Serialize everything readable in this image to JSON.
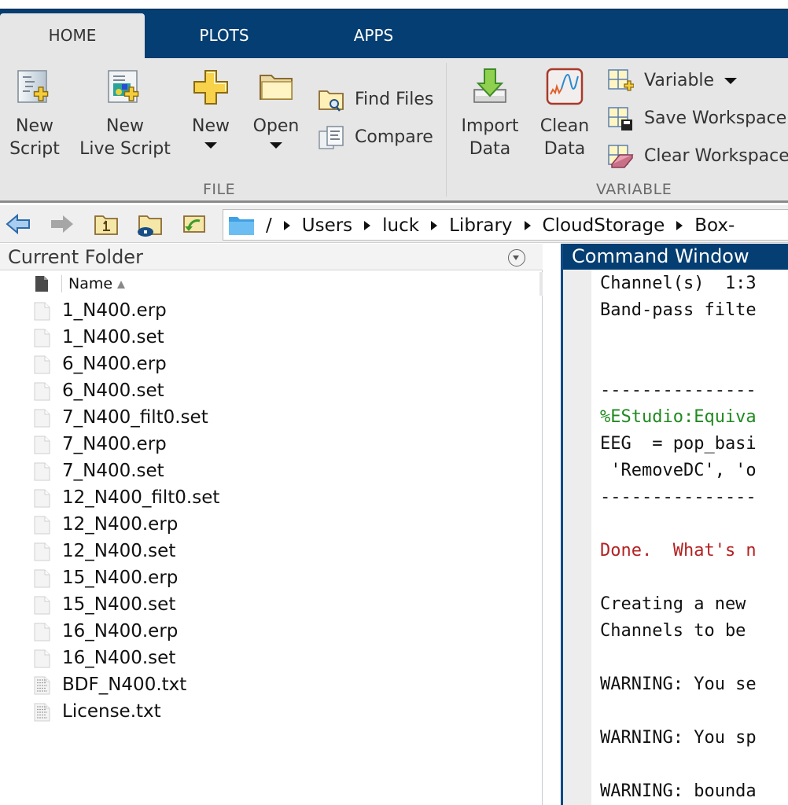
{
  "tabs": [
    {
      "label": "HOME",
      "active": true
    },
    {
      "label": "PLOTS",
      "active": false
    },
    {
      "label": "APPS",
      "active": false
    }
  ],
  "ribbon": {
    "file_section": {
      "label": "FILE",
      "new_script": {
        "line1": "New",
        "line2": "Script",
        "icon": "new-script-icon"
      },
      "new_live_script": {
        "line1": "New",
        "line2": "Live Script",
        "icon": "new-live-script-icon"
      },
      "new": {
        "label": "New",
        "icon": "plus-icon"
      },
      "open": {
        "label": "Open",
        "icon": "folder-icon"
      },
      "find_files": {
        "label": "Find Files",
        "icon": "find-files-icon"
      },
      "compare": {
        "label": "Compare",
        "icon": "compare-icon"
      }
    },
    "variable_section": {
      "label": "VARIABLE",
      "import_data": {
        "line1": "Import",
        "line2": "Data",
        "icon": "import-arrow-icon"
      },
      "clean_data": {
        "line1": "Clean",
        "line2": "Data",
        "icon": "clean-data-icon"
      },
      "variable": {
        "label": "Variable",
        "icon": "new-variable-icon"
      },
      "save_workspace": {
        "label": "Save Workspace",
        "icon": "save-workspace-icon"
      },
      "clear_workspace": {
        "label": "Clear Workspace",
        "icon": "clear-workspace-icon"
      }
    }
  },
  "navbar": {
    "buttons": [
      "back-arrow-icon",
      "forward-arrow-icon",
      "up-folder-icon",
      "browse-folder-icon",
      "refresh-folder-icon"
    ],
    "path_root": "/",
    "path": [
      "Users",
      "luck",
      "Library",
      "CloudStorage",
      "Box-"
    ]
  },
  "current_folder": {
    "title": "Current Folder",
    "column_header": "Name",
    "sort": "ascending",
    "files": [
      {
        "name": "1_N400.erp",
        "type": "generic"
      },
      {
        "name": "1_N400.set",
        "type": "generic"
      },
      {
        "name": "6_N400.erp",
        "type": "generic"
      },
      {
        "name": "6_N400.set",
        "type": "generic"
      },
      {
        "name": "7_N400_filt0.set",
        "type": "generic"
      },
      {
        "name": "7_N400.erp",
        "type": "generic"
      },
      {
        "name": "7_N400.set",
        "type": "generic"
      },
      {
        "name": "12_N400_filt0.set",
        "type": "generic"
      },
      {
        "name": "12_N400.erp",
        "type": "generic"
      },
      {
        "name": "12_N400.set",
        "type": "generic"
      },
      {
        "name": "15_N400.erp",
        "type": "generic"
      },
      {
        "name": "15_N400.set",
        "type": "generic"
      },
      {
        "name": "16_N400.erp",
        "type": "generic"
      },
      {
        "name": "16_N400.set",
        "type": "generic"
      },
      {
        "name": "BDF_N400.txt",
        "type": "text"
      },
      {
        "name": "License.txt",
        "type": "text"
      }
    ]
  },
  "command_window": {
    "title": "Command Window",
    "lines": [
      {
        "text": "Channel(s)  1:3",
        "color": "default"
      },
      {
        "text": "Band-pass filte",
        "color": "default"
      },
      {
        "text": "",
        "color": "default"
      },
      {
        "text": "",
        "color": "default"
      },
      {
        "text": "---------------",
        "color": "default"
      },
      {
        "text": "%EStudio:Equiva",
        "color": "green"
      },
      {
        "text": "EEG  = pop_basi",
        "color": "default"
      },
      {
        "text": " 'RemoveDC', 'o",
        "color": "default"
      },
      {
        "text": "---------------",
        "color": "default"
      },
      {
        "text": "",
        "color": "default"
      },
      {
        "text": "Done.  What's n",
        "color": "red"
      },
      {
        "text": "",
        "color": "default"
      },
      {
        "text": "Creating a new ",
        "color": "default"
      },
      {
        "text": "Channels to be ",
        "color": "default"
      },
      {
        "text": "",
        "color": "default"
      },
      {
        "text": "WARNING: You se",
        "color": "default"
      },
      {
        "text": "",
        "color": "default"
      },
      {
        "text": "WARNING: You sp",
        "color": "default"
      },
      {
        "text": "",
        "color": "default"
      },
      {
        "text": "WARNING: bounda",
        "color": "default"
      }
    ],
    "colors": {
      "green": "#208a20",
      "red": "#b42222"
    }
  },
  "theme": {
    "toolstrip_blue": "#043e72",
    "ribbon_gray": "#e6e6e6"
  }
}
